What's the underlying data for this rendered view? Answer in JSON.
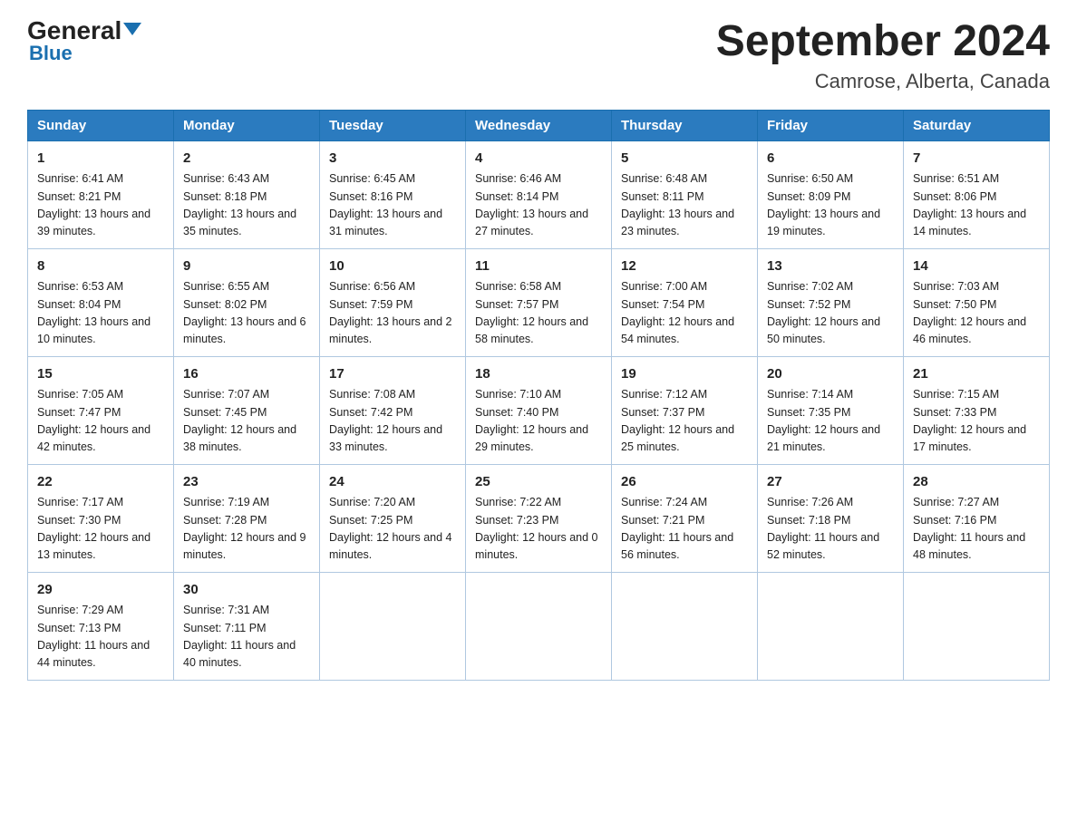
{
  "header": {
    "logo_general": "General",
    "logo_blue": "Blue",
    "month_title": "September 2024",
    "location": "Camrose, Alberta, Canada"
  },
  "weekdays": [
    "Sunday",
    "Monday",
    "Tuesday",
    "Wednesday",
    "Thursday",
    "Friday",
    "Saturday"
  ],
  "weeks": [
    [
      {
        "day": "1",
        "sunrise": "6:41 AM",
        "sunset": "8:21 PM",
        "daylight": "13 hours and 39 minutes."
      },
      {
        "day": "2",
        "sunrise": "6:43 AM",
        "sunset": "8:18 PM",
        "daylight": "13 hours and 35 minutes."
      },
      {
        "day": "3",
        "sunrise": "6:45 AM",
        "sunset": "8:16 PM",
        "daylight": "13 hours and 31 minutes."
      },
      {
        "day": "4",
        "sunrise": "6:46 AM",
        "sunset": "8:14 PM",
        "daylight": "13 hours and 27 minutes."
      },
      {
        "day": "5",
        "sunrise": "6:48 AM",
        "sunset": "8:11 PM",
        "daylight": "13 hours and 23 minutes."
      },
      {
        "day": "6",
        "sunrise": "6:50 AM",
        "sunset": "8:09 PM",
        "daylight": "13 hours and 19 minutes."
      },
      {
        "day": "7",
        "sunrise": "6:51 AM",
        "sunset": "8:06 PM",
        "daylight": "13 hours and 14 minutes."
      }
    ],
    [
      {
        "day": "8",
        "sunrise": "6:53 AM",
        "sunset": "8:04 PM",
        "daylight": "13 hours and 10 minutes."
      },
      {
        "day": "9",
        "sunrise": "6:55 AM",
        "sunset": "8:02 PM",
        "daylight": "13 hours and 6 minutes."
      },
      {
        "day": "10",
        "sunrise": "6:56 AM",
        "sunset": "7:59 PM",
        "daylight": "13 hours and 2 minutes."
      },
      {
        "day": "11",
        "sunrise": "6:58 AM",
        "sunset": "7:57 PM",
        "daylight": "12 hours and 58 minutes."
      },
      {
        "day": "12",
        "sunrise": "7:00 AM",
        "sunset": "7:54 PM",
        "daylight": "12 hours and 54 minutes."
      },
      {
        "day": "13",
        "sunrise": "7:02 AM",
        "sunset": "7:52 PM",
        "daylight": "12 hours and 50 minutes."
      },
      {
        "day": "14",
        "sunrise": "7:03 AM",
        "sunset": "7:50 PM",
        "daylight": "12 hours and 46 minutes."
      }
    ],
    [
      {
        "day": "15",
        "sunrise": "7:05 AM",
        "sunset": "7:47 PM",
        "daylight": "12 hours and 42 minutes."
      },
      {
        "day": "16",
        "sunrise": "7:07 AM",
        "sunset": "7:45 PM",
        "daylight": "12 hours and 38 minutes."
      },
      {
        "day": "17",
        "sunrise": "7:08 AM",
        "sunset": "7:42 PM",
        "daylight": "12 hours and 33 minutes."
      },
      {
        "day": "18",
        "sunrise": "7:10 AM",
        "sunset": "7:40 PM",
        "daylight": "12 hours and 29 minutes."
      },
      {
        "day": "19",
        "sunrise": "7:12 AM",
        "sunset": "7:37 PM",
        "daylight": "12 hours and 25 minutes."
      },
      {
        "day": "20",
        "sunrise": "7:14 AM",
        "sunset": "7:35 PM",
        "daylight": "12 hours and 21 minutes."
      },
      {
        "day": "21",
        "sunrise": "7:15 AM",
        "sunset": "7:33 PM",
        "daylight": "12 hours and 17 minutes."
      }
    ],
    [
      {
        "day": "22",
        "sunrise": "7:17 AM",
        "sunset": "7:30 PM",
        "daylight": "12 hours and 13 minutes."
      },
      {
        "day": "23",
        "sunrise": "7:19 AM",
        "sunset": "7:28 PM",
        "daylight": "12 hours and 9 minutes."
      },
      {
        "day": "24",
        "sunrise": "7:20 AM",
        "sunset": "7:25 PM",
        "daylight": "12 hours and 4 minutes."
      },
      {
        "day": "25",
        "sunrise": "7:22 AM",
        "sunset": "7:23 PM",
        "daylight": "12 hours and 0 minutes."
      },
      {
        "day": "26",
        "sunrise": "7:24 AM",
        "sunset": "7:21 PM",
        "daylight": "11 hours and 56 minutes."
      },
      {
        "day": "27",
        "sunrise": "7:26 AM",
        "sunset": "7:18 PM",
        "daylight": "11 hours and 52 minutes."
      },
      {
        "day": "28",
        "sunrise": "7:27 AM",
        "sunset": "7:16 PM",
        "daylight": "11 hours and 48 minutes."
      }
    ],
    [
      {
        "day": "29",
        "sunrise": "7:29 AM",
        "sunset": "7:13 PM",
        "daylight": "11 hours and 44 minutes."
      },
      {
        "day": "30",
        "sunrise": "7:31 AM",
        "sunset": "7:11 PM",
        "daylight": "11 hours and 40 minutes."
      },
      null,
      null,
      null,
      null,
      null
    ]
  ]
}
